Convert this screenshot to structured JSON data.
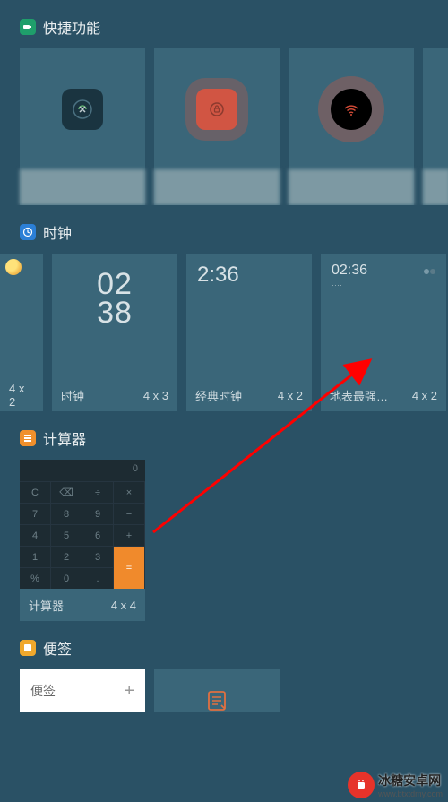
{
  "sections": {
    "quick": {
      "title": "快捷功能"
    },
    "clock": {
      "title": "时钟",
      "cards": [
        {
          "name": "",
          "size": "4 x 2"
        },
        {
          "name": "时钟",
          "size": "4 x 3",
          "time_top": "02",
          "time_bot": "38"
        },
        {
          "name": "经典时钟",
          "size": "4 x 2",
          "time": "2:36"
        },
        {
          "name": "地表最强…",
          "size": "4 x 2",
          "time": "02:36"
        }
      ]
    },
    "calculator": {
      "title": "计算器",
      "footer_name": "计算器",
      "footer_size": "4 x 4",
      "display": "0",
      "keys": [
        "C",
        "⌫",
        "÷",
        "×",
        "7",
        "8",
        "9",
        "−",
        "4",
        "5",
        "6",
        "+",
        "1",
        "2",
        "3",
        "=",
        "%",
        "0",
        "."
      ]
    },
    "notes": {
      "title": "便签",
      "card1_label": "便签"
    }
  },
  "watermark": {
    "text": "冰糖安卓网",
    "url": "www.btxtdmy.com"
  }
}
